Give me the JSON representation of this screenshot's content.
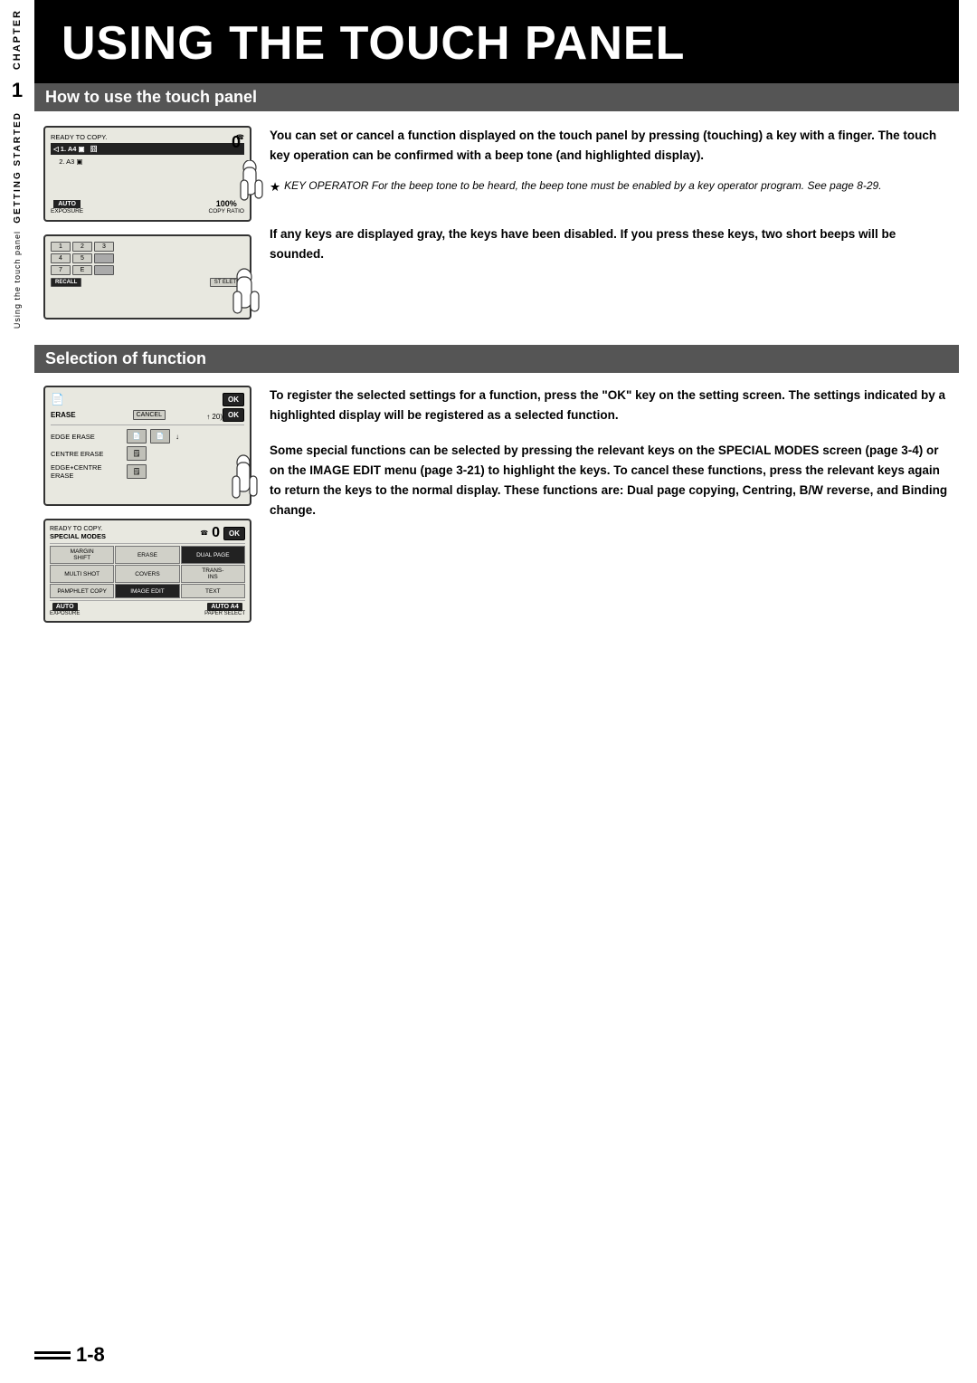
{
  "page": {
    "title": "USING THE TOUCH PANEL",
    "page_number": "1-8"
  },
  "sidebar": {
    "chapter_label": "CHAPTER",
    "chapter_number": "1",
    "getting_started": "GETTING STARTED",
    "sub_label": "Using the touch panel"
  },
  "section1": {
    "header": "How to use the touch panel",
    "paragraph1": "You can set or cancel a function displayed on the touch panel by pressing (touching) a key with a finger. The touch key operation can be confirmed with a beep tone (and highlighted display).",
    "note_star": "★",
    "note_text": "KEY OPERATOR  For the beep tone to be heard, the beep tone must be enabled by a key operator program. See page 8-29.",
    "paragraph2": "If any keys are displayed gray, the keys have been disabled. If you press these keys, two short beeps will be sounded."
  },
  "section2": {
    "header": "Selection of function",
    "paragraph1": "To register the selected settings for a function, press the \"OK\" key on the setting screen. The settings indicated by a highlighted display will be registered as a selected function.",
    "paragraph2": "Some special functions can be selected by pressing the relevant keys on the SPECIAL MODES screen (page 3-4) or on the IMAGE EDIT menu (page 3-21) to highlight the keys. To cancel these functions, press the relevant keys again to return the keys to the normal display. These functions are: Dual page copying, Centring, B/W reverse, and Binding change."
  },
  "lcd1": {
    "status": "READY TO COPY.",
    "row1": "1. A4",
    "row2": "2. A3",
    "exposure_label": "AUTO",
    "exposure_text": "EXPOSURE",
    "copy_ratio": "100%",
    "copy_ratio_label": "COPY RATIO",
    "number": "0"
  },
  "lcd2": {
    "numbers": [
      "1",
      "2",
      "3",
      "4",
      "5",
      "",
      "7",
      "E",
      ""
    ],
    "recall_label": "RECALL",
    "store_delete_label": "ST  ELETE"
  },
  "lcd_erase": {
    "top_icon": "📄",
    "erase_label": "ERASE",
    "cancel_label": "CANCEL",
    "ok_label": "OK",
    "edge_erase": "EDGE ERASE",
    "centre_erase": "CENTRE ERASE",
    "edge_centre": "EDGE+CENTRE",
    "erase2": "ERASE"
  },
  "lcd_special": {
    "status": "READY TO COPY.",
    "special_modes": "SPECIAL MODES",
    "ok_label": "OK",
    "cells": [
      "MARGIN SHIFT",
      "ERASE",
      "DUAL PAGE",
      "MULTI SHOT",
      "COVERS",
      "TRANS-\nINS",
      "PAMPHLET COPY",
      "IMAGE EDIT",
      "TEXT"
    ],
    "exposure_label": "AUTO",
    "exposure_text": "EXPOSURE",
    "paper_select": "AUTO A4",
    "paper_select_label": "PAPER SELECT",
    "number": "0"
  }
}
